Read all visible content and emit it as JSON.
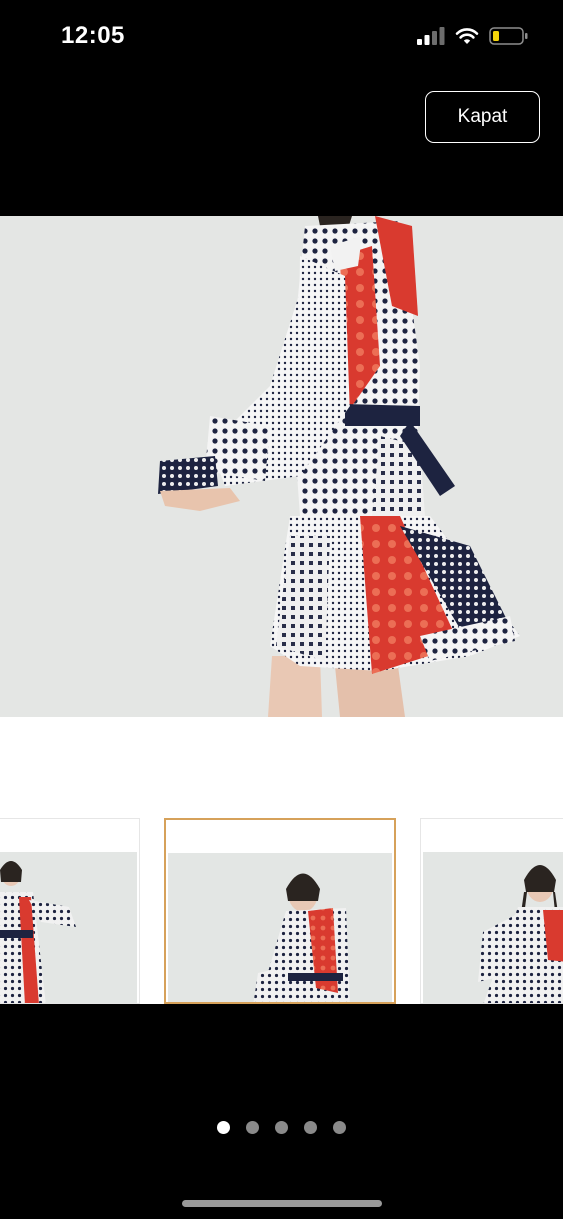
{
  "status_bar": {
    "time": "12:05"
  },
  "header": {
    "close_label": "Kapat"
  },
  "gallery": {
    "thumbnails": [
      {
        "state": "inactive"
      },
      {
        "state": "active"
      },
      {
        "state": "inactive"
      }
    ],
    "pagination": {
      "total": 5,
      "current": 1
    }
  },
  "colors": {
    "background": "#000000",
    "panel": "#ffffff",
    "photo_bg": "#e4e6e4",
    "accent_selected": "#d6a15a",
    "dress_red": "#d93a2f",
    "dress_navy": "#1d2340",
    "battery_fill": "#f5d40a"
  }
}
